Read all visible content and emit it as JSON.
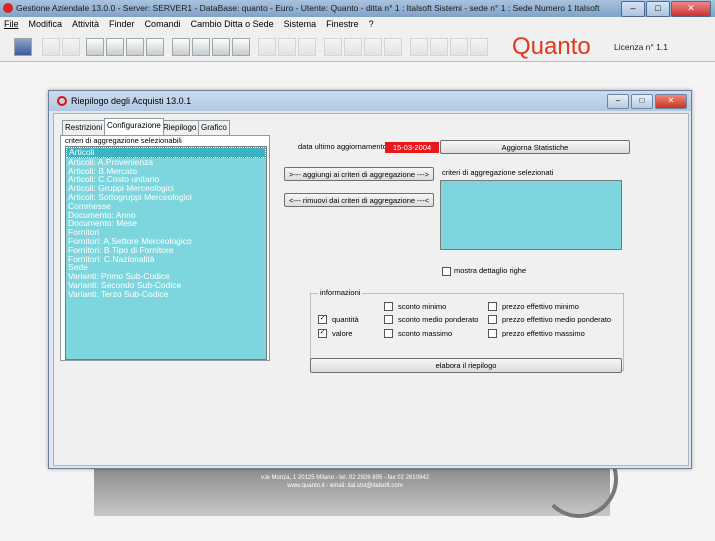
{
  "app": {
    "title": "Gestione Aziendale 13.0.0 - Server: SERVER1 - DataBase: quanto - Euro - Utente: Quanto - ditta n° 1 : Italsoft Sistemi - sede n° 1 : Sede Numero 1 Italsoft",
    "brand": "Quanto",
    "license": "Licenza n° 1.1",
    "window_buttons": [
      "–",
      "□",
      "✕"
    ]
  },
  "menu": [
    "File",
    "Modifica",
    "Attività",
    "Finder",
    "Comandi",
    "Cambio Ditta o Sede",
    "Sistema",
    "Finestre",
    "?"
  ],
  "background_footer": {
    "line1": "v.le Monza, 1 20125 Milano - tel. 02 2826 895 - fax 02 2610942",
    "line2": "www.quanto.it - email: ital.stst@italsoft.com"
  },
  "dialog": {
    "title": "Riepilogo degli Acquisti 13.0.1",
    "tabs": [
      "Restrizioni",
      "Configurazione",
      "Riepilogo",
      "Grafico"
    ],
    "active_tab": "Configurazione",
    "left_label": "criteri di aggregazione selezionabili",
    "criteria": [
      "Articoli",
      "Articoli: A.Provenienza",
      "Articoli: B.Mercato",
      "Articoli: C.Costo unitario",
      "Articoli: Gruppi Merceologici",
      "Articoli: Sottogruppi Merceologici",
      "Commesse",
      "Documento: Anno",
      "Documento: Mese",
      "Fornitori",
      "Fornitori: A.Settore Merceologico",
      "Fornitori: B.Tipo di Fornitore",
      "Fornitori: C.Nazionalità",
      "Sede",
      "Varianti: Primo Sub-Codice",
      "Varianti: Secondo Sub-Codice",
      "Varianti: Terzo Sub-Codice"
    ],
    "update_label": "data ultimo aggiornamento:",
    "update_date": "15-03-2004",
    "update_button": "Aggiorna Statistiche",
    "add_button": ">--- aggiungi ai criteri di aggregazione --->",
    "remove_button": "<--- rimuovi dai criteri di aggregazione ---<",
    "right_label": "criteri di aggregazione selezionati",
    "detail_checkbox": "mostra dettaglio righe",
    "info_group": "informazioni",
    "info_options": [
      {
        "label": "quantità",
        "checked": true
      },
      {
        "label": "valore",
        "checked": true
      },
      {
        "label": "sconto minimo",
        "checked": false
      },
      {
        "label": "sconto medio ponderato",
        "checked": false
      },
      {
        "label": "sconto massimo",
        "checked": false
      },
      {
        "label": "prezzo effettivo minimo",
        "checked": false
      },
      {
        "label": "prezzo effettivo medio ponderato",
        "checked": false
      },
      {
        "label": "prezzo effettivo massimo",
        "checked": false
      }
    ],
    "run_button": "elabora il riepilogo"
  }
}
